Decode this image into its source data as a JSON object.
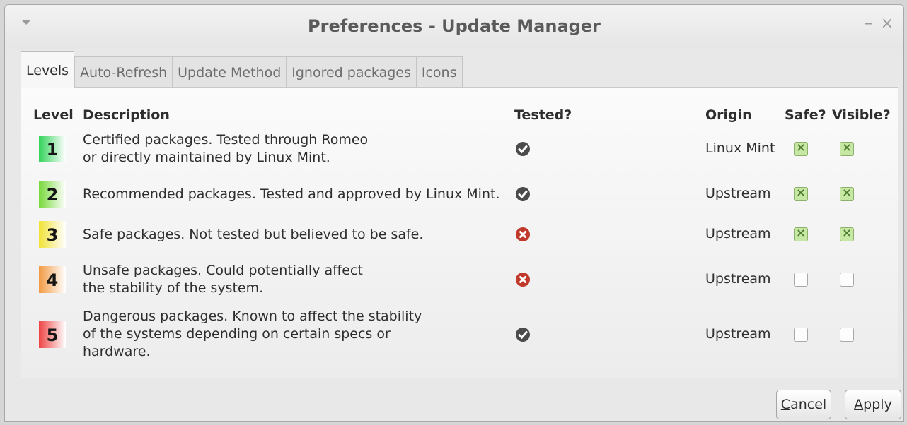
{
  "window": {
    "title": "Preferences - Update Manager"
  },
  "tabs": [
    {
      "label": "Levels",
      "active": true
    },
    {
      "label": "Auto-Refresh",
      "active": false
    },
    {
      "label": "Update Method",
      "active": false
    },
    {
      "label": "Ignored packages",
      "active": false
    },
    {
      "label": "Icons",
      "active": false
    }
  ],
  "table": {
    "headers": {
      "level": "Level",
      "description": "Description",
      "tested": "Tested?",
      "origin": "Origin",
      "safe": "Safe?",
      "visible": "Visible?"
    },
    "rows": [
      {
        "level": "1",
        "level_color": "#33d35a",
        "description": [
          "Certified packages. Tested through Romeo",
          "or directly maintained by Linux Mint."
        ],
        "tested": "check",
        "origin": "Linux Mint",
        "safe": true,
        "visible": true
      },
      {
        "level": "2",
        "level_color": "#77d93a",
        "description": [
          "Recommended packages. Tested and approved by Linux Mint."
        ],
        "tested": "check",
        "origin": "Upstream",
        "safe": true,
        "visible": true
      },
      {
        "level": "3",
        "level_color": "#f1e236",
        "description": [
          "Safe packages. Not tested but believed to be safe."
        ],
        "tested": "cross",
        "origin": "Upstream",
        "safe": true,
        "visible": true
      },
      {
        "level": "4",
        "level_color": "#f29a43",
        "description": [
          "Unsafe packages. Could potentially affect",
          "the stability of the system."
        ],
        "tested": "cross",
        "origin": "Upstream",
        "safe": false,
        "visible": false
      },
      {
        "level": "5",
        "level_color": "#ee4444",
        "description": [
          "Dangerous packages. Known to affect the stability",
          "of the systems depending on certain specs or",
          "hardware."
        ],
        "tested": "check",
        "origin": "Upstream",
        "safe": false,
        "visible": false
      }
    ]
  },
  "buttons": {
    "cancel": {
      "mnemonic": "C",
      "rest": "ancel"
    },
    "apply": {
      "mnemonic": "A",
      "rest": "pply"
    }
  },
  "colors": {
    "check_icon": "#4b4b4b",
    "cross_icon": "#c0392b"
  },
  "icons": {
    "tested_yes": "check-circle-icon",
    "tested_no": "cross-circle-icon"
  }
}
